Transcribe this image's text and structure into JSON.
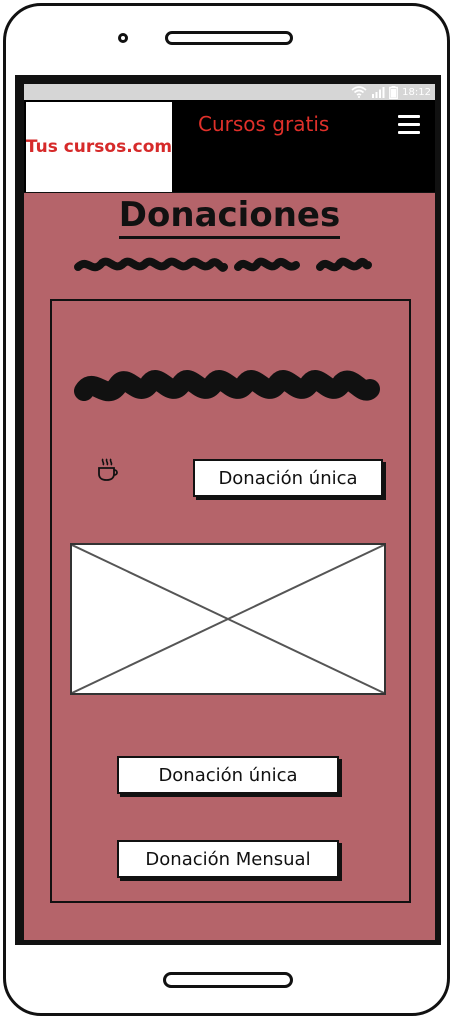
{
  "status_bar": {
    "time": "18:12"
  },
  "header": {
    "logo_text": "Tus cursos.com",
    "title": "Cursos gratis",
    "menu_icon": "hamburger-icon"
  },
  "page": {
    "title": "Donaciones"
  },
  "card": {
    "icon": "coffee-cup-icon",
    "single_donation_top_label": "Donación única",
    "image": "image-placeholder",
    "single_donation_label": "Donación única",
    "monthly_donation_label": "Donación Mensual"
  },
  "colors": {
    "content_background": "#b5646a",
    "header_background": "#000000",
    "accent_red": "#d62a2a"
  }
}
